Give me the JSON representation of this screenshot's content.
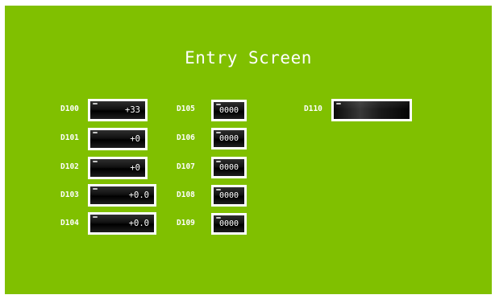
{
  "screen": {
    "title": "Entry Screen",
    "background": "#80c000"
  },
  "registers": {
    "D100": {
      "label": "D100",
      "value": "+33"
    },
    "D101": {
      "label": "D101",
      "value": "+0"
    },
    "D102": {
      "label": "D102",
      "value": "+0"
    },
    "D103": {
      "label": "D103",
      "value": "+0.0"
    },
    "D104": {
      "label": "D104",
      "value": "+0.0"
    },
    "D105": {
      "label": "D105",
      "value": "0000"
    },
    "D106": {
      "label": "D106",
      "value": "0000"
    },
    "D107": {
      "label": "D107",
      "value": "0000"
    },
    "D108": {
      "label": "D108",
      "value": "0000"
    },
    "D109": {
      "label": "D109",
      "value": "0000"
    },
    "D110": {
      "label": "D110",
      "value": ""
    }
  }
}
